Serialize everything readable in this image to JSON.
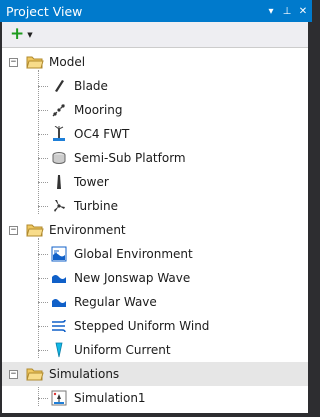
{
  "window": {
    "title": "Project View",
    "controls": [
      "▾",
      "⊥",
      "✕"
    ]
  },
  "toolbar": {
    "add_label": "+",
    "dropdown_glyph": "▼"
  },
  "tree": {
    "categories": [
      {
        "label": "Model",
        "expanded": true,
        "children": [
          {
            "label": "Blade",
            "icon": "blade-icon"
          },
          {
            "label": "Mooring",
            "icon": "mooring-icon"
          },
          {
            "label": "OC4 FWT",
            "icon": "fwt-icon"
          },
          {
            "label": "Semi-Sub Platform",
            "icon": "platform-icon"
          },
          {
            "label": "Tower",
            "icon": "tower-icon"
          },
          {
            "label": "Turbine",
            "icon": "turbine-icon"
          }
        ]
      },
      {
        "label": "Environment",
        "expanded": true,
        "children": [
          {
            "label": "Global Environment",
            "icon": "global-environment-icon"
          },
          {
            "label": "New Jonswap Wave",
            "icon": "wave-icon"
          },
          {
            "label": "Regular Wave",
            "icon": "wave-icon"
          },
          {
            "label": "Stepped Uniform Wind",
            "icon": "wind-icon"
          },
          {
            "label": "Uniform Current",
            "icon": "current-icon"
          }
        ]
      },
      {
        "label": "Simulations",
        "expanded": true,
        "selected": true,
        "children": [
          {
            "label": "Simulation1",
            "icon": "simulation-icon"
          }
        ]
      }
    ]
  },
  "colors": {
    "titlebar": "#007acc",
    "accent_green": "#1e9b1e",
    "folder": "#f0c860",
    "icon_blue": "#1060c8",
    "selection": "#e6e6e6"
  }
}
